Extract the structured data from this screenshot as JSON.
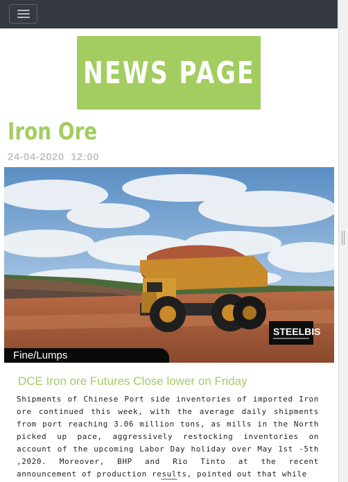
{
  "navbar": {
    "menu_icon": "hamburger-menu-icon"
  },
  "banner": {
    "text": "NEWS PAGE"
  },
  "article": {
    "title": "Iron Ore",
    "date": "24-04-2020  12:00",
    "image": {
      "category_tag": "Fine/Lumps",
      "watermark": "STEELBIS"
    },
    "headline": "DCE Iron ore Futures Close lower on Friday",
    "body": "Shipments of Chinese Port side inventories of imported Iron ore continued this week, with the average daily shipments from port reaching 3.06 million tons, as mills in the North picked up pace, aggressively restocking inventories on account of the upcoming Labor Day holiday over May 1st -5th ,2020. Moreover, BHP and Rio Tinto at the recent announcement of production results, pointed out that while"
  },
  "colors": {
    "accent": "#a3cd60",
    "navbar": "#343a40"
  }
}
